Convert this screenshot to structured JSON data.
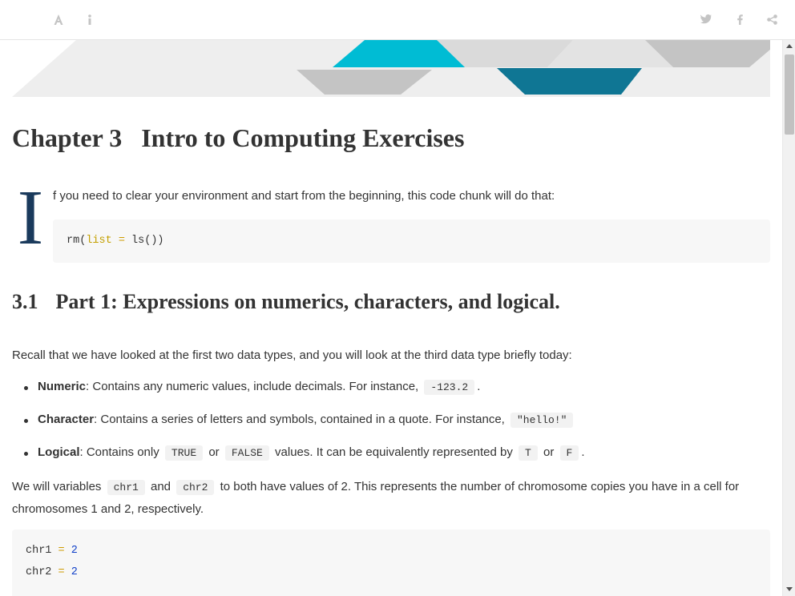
{
  "toolbar": {
    "left_icons": [
      "font-settings-icon",
      "info-icon"
    ],
    "right_icons": [
      "twitter-icon",
      "facebook-icon",
      "share-icon"
    ],
    "colors": {
      "icon": "#c4c4c4"
    }
  },
  "banner": {
    "colors": [
      "#e6e6e6",
      "#c8c8c8",
      "#00bcd4",
      "#0f7694"
    ]
  },
  "chapter": {
    "number": "Chapter 3",
    "title": "Intro to Computing Exercises"
  },
  "intro": {
    "dropcap": "I",
    "text": "f you need to clear your environment and start from the beginning, this code chunk will do that:",
    "dropcap_color": "#1a3a5c"
  },
  "code1": {
    "fn": "rm(",
    "arg": "list",
    "op": " = ",
    "rest": "ls())"
  },
  "section": {
    "number": "3.1",
    "title": "Part 1: Expressions on numerics, characters, and logical."
  },
  "recall_text": "Recall that we have looked at the first two data types, and you will look at the third data type briefly today:",
  "types": [
    {
      "term": "Numeric",
      "desc": ": Contains any numeric values, include decimals. For instance,",
      "code": "-123.2",
      "end": "."
    },
    {
      "term": "Character",
      "desc": ": Contains a series of letters and symbols, contained in a quote. For instance,",
      "code": "\"hello!\"",
      "end": ""
    },
    {
      "term": "Logical",
      "desc": ": Contains only",
      "code1": "TRUE",
      "mid1": "or",
      "code2": "FALSE",
      "mid2": "values. It can be equivalently represented by",
      "code3": "T",
      "mid3": "or",
      "code4": "F",
      "end": "."
    }
  ],
  "vars": {
    "before": "We will variables",
    "code1": "chr1",
    "and": "and",
    "code2": "chr2",
    "after": "to both have values of 2. This represents the number of chromosome copies you have in a cell for chromosomes 1 and 2, respectively."
  },
  "code2": [
    {
      "var": "chr1",
      "op": " = ",
      "val": "2"
    },
    {
      "var": "chr2",
      "op": " = ",
      "val": "2"
    }
  ]
}
